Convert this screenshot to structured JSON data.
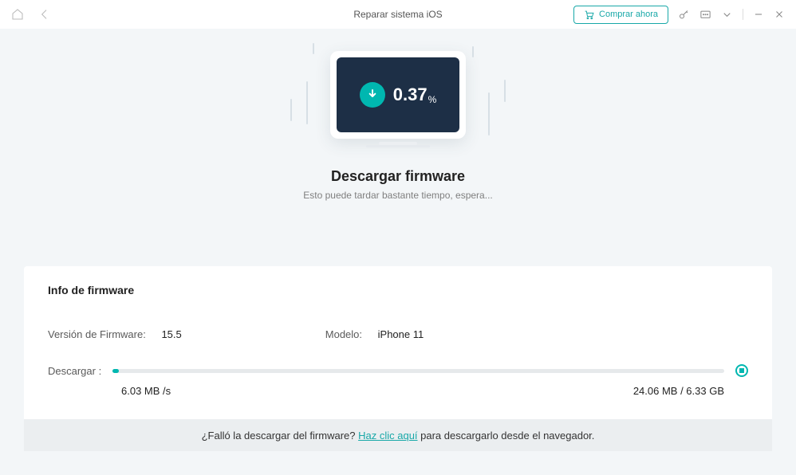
{
  "titlebar": {
    "title": "Reparar sistema iOS",
    "buy": "Comprar ahora"
  },
  "download": {
    "percent": "0.37",
    "percent_sign": "%",
    "heading": "Descargar firmware",
    "sub": "Esto puede tardar bastante tiempo, espera..."
  },
  "card": {
    "title": "Info de firmware",
    "fw_label": "Versión de Firmware:",
    "fw_value": "15.5",
    "model_label": "Modelo:",
    "model_value": "iPhone 11",
    "download_label": "Descargar :",
    "speed": "6.03 MB /s",
    "progress_text": "24.06 MB / 6.33 GB"
  },
  "footer": {
    "prefix": "¿Falló la descargar del firmware? ",
    "link": "Haz clic aquí",
    "suffix": " para descargarlo desde el navegador."
  }
}
